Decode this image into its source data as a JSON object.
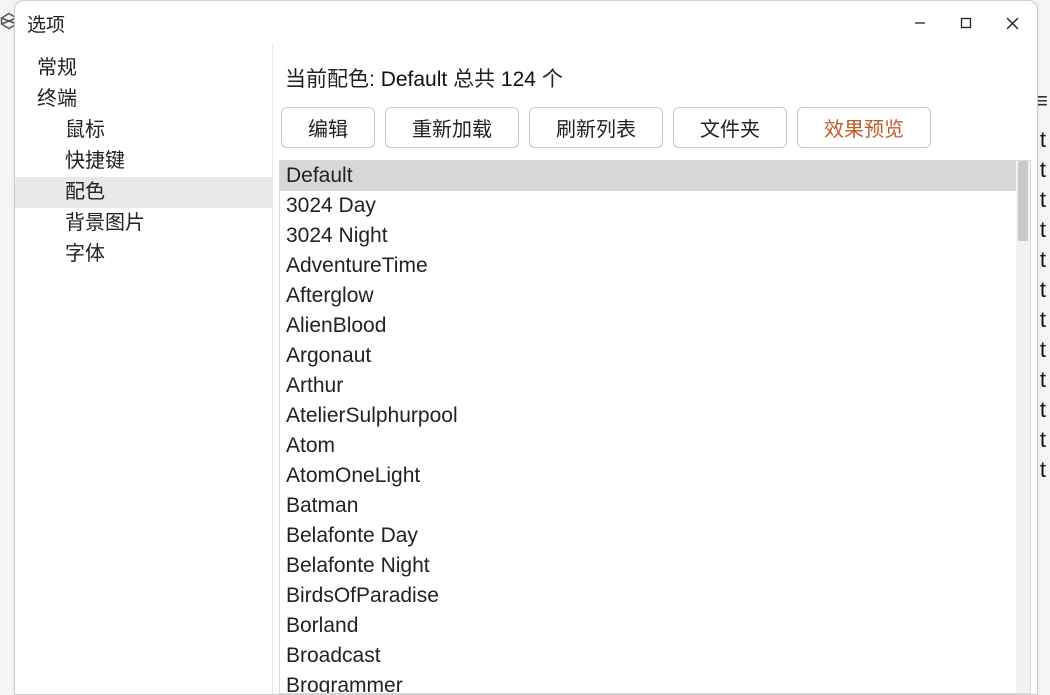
{
  "window": {
    "title": "选项"
  },
  "sidebar": {
    "items": [
      {
        "label": "常规",
        "level": 0,
        "selected": false
      },
      {
        "label": "终端",
        "level": 0,
        "selected": false
      },
      {
        "label": "鼠标",
        "level": 1,
        "selected": false
      },
      {
        "label": "快捷键",
        "level": 1,
        "selected": false
      },
      {
        "label": "配色",
        "level": 1,
        "selected": true
      },
      {
        "label": "背景图片",
        "level": 1,
        "selected": false
      },
      {
        "label": "字体",
        "level": 1,
        "selected": false
      }
    ]
  },
  "main": {
    "status": {
      "label_current": "当前配色:",
      "scheme_name": "Default",
      "label_total_prefix": "总共",
      "count": "124",
      "label_total_suffix": "个"
    },
    "buttons": {
      "edit": "编辑",
      "reload": "重新加载",
      "refresh_list": "刷新列表",
      "folder": "文件夹",
      "preview": "效果预览"
    },
    "schemes": [
      {
        "name": "Default",
        "selected": true
      },
      {
        "name": "3024 Day",
        "selected": false
      },
      {
        "name": "3024 Night",
        "selected": false
      },
      {
        "name": "AdventureTime",
        "selected": false
      },
      {
        "name": "Afterglow",
        "selected": false
      },
      {
        "name": "AlienBlood",
        "selected": false
      },
      {
        "name": "Argonaut",
        "selected": false
      },
      {
        "name": "Arthur",
        "selected": false
      },
      {
        "name": "AtelierSulphurpool",
        "selected": false
      },
      {
        "name": "Atom",
        "selected": false
      },
      {
        "name": "AtomOneLight",
        "selected": false
      },
      {
        "name": "Batman",
        "selected": false
      },
      {
        "name": "Belafonte Day",
        "selected": false
      },
      {
        "name": "Belafonte Night",
        "selected": false
      },
      {
        "name": "BirdsOfParadise",
        "selected": false
      },
      {
        "name": "Borland",
        "selected": false
      },
      {
        "name": "Broadcast",
        "selected": false
      },
      {
        "name": "Brogrammer",
        "selected": false
      }
    ]
  },
  "background": {
    "t_char": "t"
  }
}
